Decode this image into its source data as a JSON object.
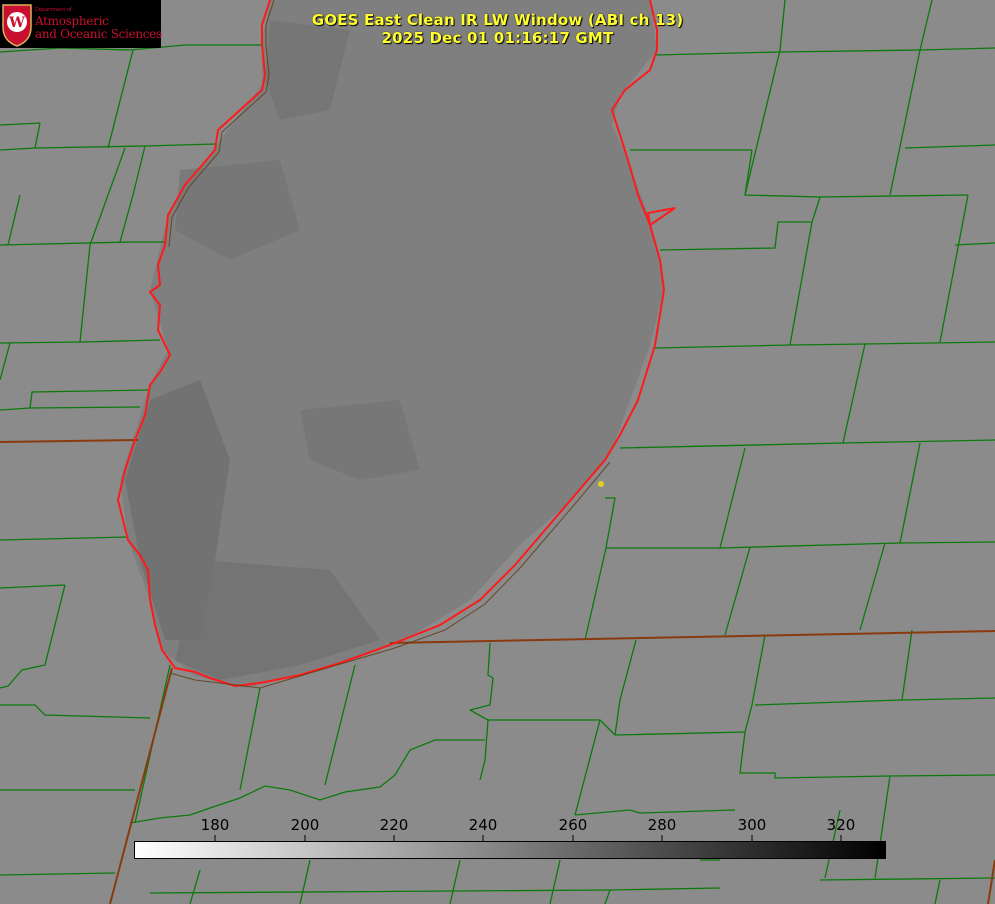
{
  "logo": {
    "department": "Department of",
    "line1": "Atmospheric",
    "line2": "and Oceanic Sciences",
    "monogram": "W"
  },
  "title": {
    "line1": "GOES East Clean IR LW Window (ABI ch 13)",
    "line2": "2025 Dec 01 01:16:17 GMT"
  },
  "colorbar": {
    "ticks": [
      "180",
      "200",
      "220",
      "240",
      "260",
      "280",
      "300",
      "320"
    ],
    "min_value": 163,
    "max_value": 330,
    "color_low": "#ffffff",
    "color_high": "#000000"
  },
  "colors": {
    "background_gray": "#8a8a8a",
    "lake_gray": "#7e7e7e",
    "county_lines": "#0b7a0b",
    "state_lines": "#8b3a0f",
    "coastline": "#ff1a1a",
    "title_text": "#ffff30",
    "point_marker": "#e0d21a",
    "logo_red": "#c8102e"
  }
}
